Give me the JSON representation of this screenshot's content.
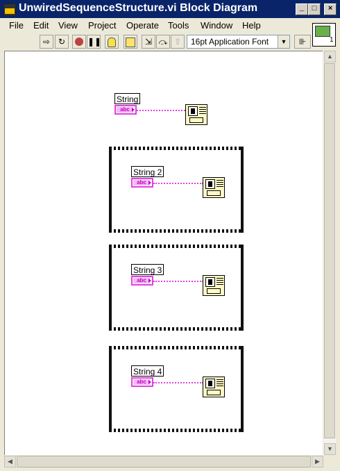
{
  "window": {
    "title": "UnwiredSequenceStructure.vi Block Diagram",
    "minimize": "_",
    "maximize": "□",
    "close": "×"
  },
  "menu": {
    "items": [
      "File",
      "Edit",
      "View",
      "Project",
      "Operate",
      "Tools",
      "Window",
      "Help"
    ]
  },
  "toolbar": {
    "font_select": "16pt Application Font",
    "connector_pane_number": "1"
  },
  "diagram": {
    "controls": [
      {
        "label": "String",
        "terminal": "abc"
      },
      {
        "label": "String 2",
        "terminal": "abc"
      },
      {
        "label": "String 3",
        "terminal": "abc"
      },
      {
        "label": "String 4",
        "terminal": "abc"
      }
    ]
  },
  "colors": {
    "titlebar": "#0a246a",
    "string_wire": "#e040e0",
    "indicator_fill": "#fff9c8"
  }
}
